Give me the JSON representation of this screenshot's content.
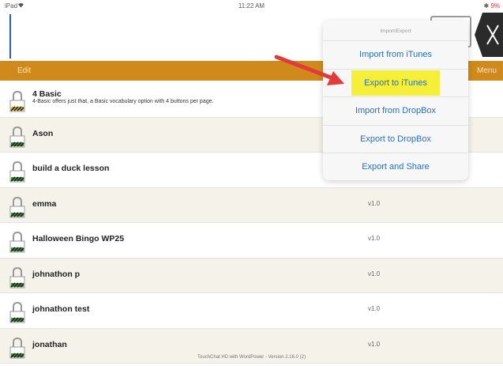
{
  "status_bar": {
    "device": "iPad",
    "wifi_icon": "wifi-icon",
    "time": "11:22 AM",
    "battery": "9%"
  },
  "toolbar": {
    "edit_label": "Edit",
    "menu_label": "Menu",
    "color": "#d08a1c"
  },
  "popover": {
    "title": "Import/Export",
    "items": [
      {
        "label": "Import from iTunes"
      },
      {
        "label": "Export to iTunes",
        "highlighted": true
      },
      {
        "label": "Import from DropBox"
      },
      {
        "label": "Export to DropBox"
      },
      {
        "label": "Export and Share"
      }
    ]
  },
  "list": {
    "rows": [
      {
        "name": "4 Basic",
        "description": "4-Basic offers just that, a Basic vocabulary option with 4 buttons per page.",
        "version": ""
      },
      {
        "name": "Ason",
        "description": "",
        "version": ""
      },
      {
        "name": "build a duck lesson",
        "description": "",
        "version": ""
      },
      {
        "name": "emma",
        "description": "",
        "version": "v1.0"
      },
      {
        "name": "Halloween Bingo WP25",
        "description": "",
        "version": "v1.0"
      },
      {
        "name": "johnathon p",
        "description": "",
        "version": "v1.0"
      },
      {
        "name": "johnathon test",
        "description": "",
        "version": "v1.0"
      },
      {
        "name": "jonathan",
        "description": "",
        "version": "v1.0"
      }
    ]
  },
  "footer": {
    "text": "TouchChat HD with WordPower - Version 2.16.0 (2)"
  },
  "colors": {
    "highlight": "#f6ef3a",
    "link_blue": "#2a6fbd",
    "arrow_red": "#e23b3b"
  }
}
